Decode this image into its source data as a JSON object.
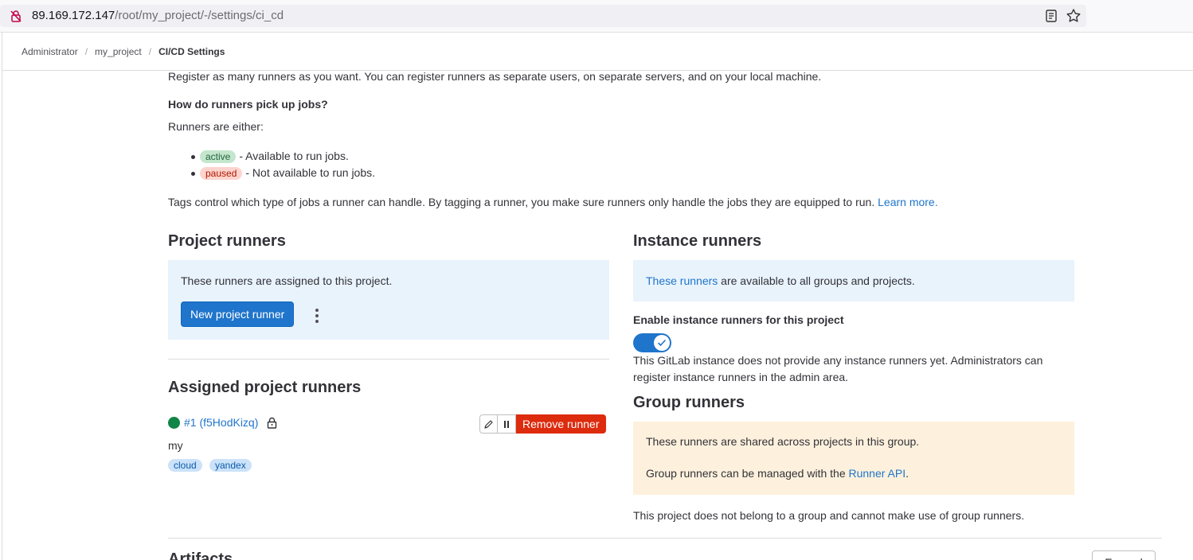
{
  "browser": {
    "url_host": "89.169.172.147",
    "url_path": "/root/my_project/-/settings/ci_cd"
  },
  "breadcrumb": {
    "items": [
      "Administrator",
      "my_project",
      "CI/CD Settings"
    ]
  },
  "intro": {
    "register_text": "Register as many runners as you want. You can register runners as separate users, on separate servers, and on your local machine.",
    "question": "How do runners pick up jobs?",
    "either": "Runners are either:",
    "statuses": [
      {
        "badge": "active",
        "text": "- Available to run jobs."
      },
      {
        "badge": "paused",
        "text": "- Not available to run jobs."
      }
    ],
    "tags_text": "Tags control which type of jobs a runner can handle. By tagging a runner, you make sure runners only handle the jobs they are equipped to run.",
    "learn_more": "Learn more."
  },
  "project_runners": {
    "title": "Project runners",
    "description": "These runners are assigned to this project.",
    "new_button": "New project runner"
  },
  "assigned": {
    "title": "Assigned project runners",
    "runner": {
      "id_label": "#1 (f5HodKizq)",
      "description": "my",
      "tags": [
        "cloud",
        "yandex"
      ],
      "remove_button": "Remove runner"
    }
  },
  "instance_runners": {
    "title": "Instance runners",
    "link": "These runners",
    "info": "are available to all groups and projects.",
    "enable_label": "Enable instance runners for this project",
    "enabled": true,
    "notice_line1": "This GitLab instance does not provide any instance runners yet. Administrators can",
    "notice_line2": "register instance runners in the admin area."
  },
  "group_runners": {
    "title": "Group runners",
    "shared_text": "These runners are shared across projects in this group.",
    "manage_text": "Group runners can be managed with the",
    "api_link": "Runner API",
    "period": ".",
    "no_group": "This project does not belong to a group and cannot make use of group runners."
  },
  "artifacts": {
    "title": "Artifacts",
    "expand_button": "Expand"
  },
  "colors": {
    "primary": "#1f75cb",
    "danger": "#dd2b0e",
    "success": "#108548"
  }
}
